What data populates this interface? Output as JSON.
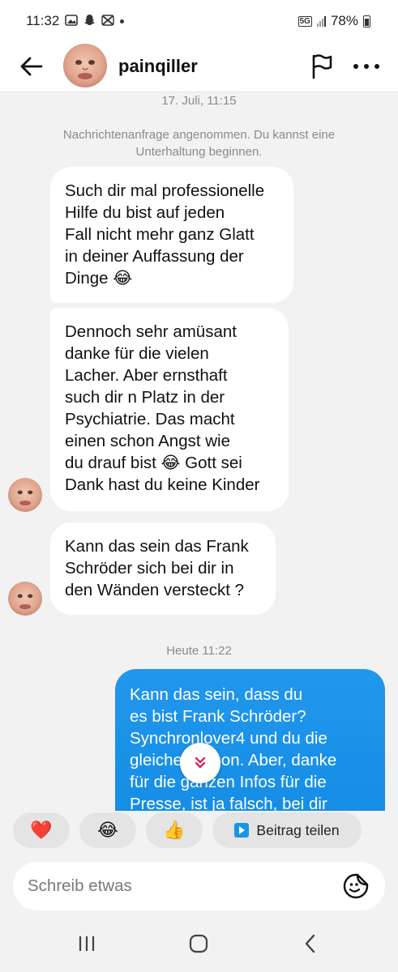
{
  "status_bar": {
    "time": "11:32",
    "network": "5G",
    "battery": "78%"
  },
  "header": {
    "username": "painqiller",
    "back_icon": "arrow-left-icon",
    "report_icon": "flag-icon",
    "more_icon": "more-horizontal-icon"
  },
  "chat": {
    "timestamp_1": "17. Juli, 11:15",
    "system_message": "Nachrichtenanfrage angenommen. Du kannst eine Unterhaltung beginnen.",
    "messages_in": [
      "Such dir mal professionelle\nHilfe du bist auf jeden\nFall nicht mehr ganz Glatt\nin deiner Auffassung der\nDinge 😂",
      "Dennoch sehr amüsant\ndanke für die vielen\nLacher. Aber ernsthaft\nsuch dir n Platz in der\nPsychiatrie. Das macht\neinen schon Angst wie\ndu drauf bist 😂 Gott sei\nDank hast du keine Kinder",
      "Kann das sein das Frank\nSchröder sich bei dir in\nden Wänden versteckt ?"
    ],
    "timestamp_2": "Heute 11:22",
    "message_out": "Kann das sein, dass du\nes bist Frank Schröder?\nSynchronlover4 und du die\ngleiche Person. Aber, danke\nfür die ganzen Infos für die\nPresse, ist ja falsch, bei dir"
  },
  "quick_reactions": {
    "heart": "❤️",
    "laugh": "😂",
    "thumbs_up": "👍",
    "share_label": "Beitrag teilen"
  },
  "composer": {
    "placeholder": "Schreib etwas"
  },
  "colors": {
    "accent_blue": "#1a93e8",
    "incoming_bubble": "#ffffff",
    "background": "#f2f2f2",
    "scroll_chevron": "#e0245e"
  }
}
